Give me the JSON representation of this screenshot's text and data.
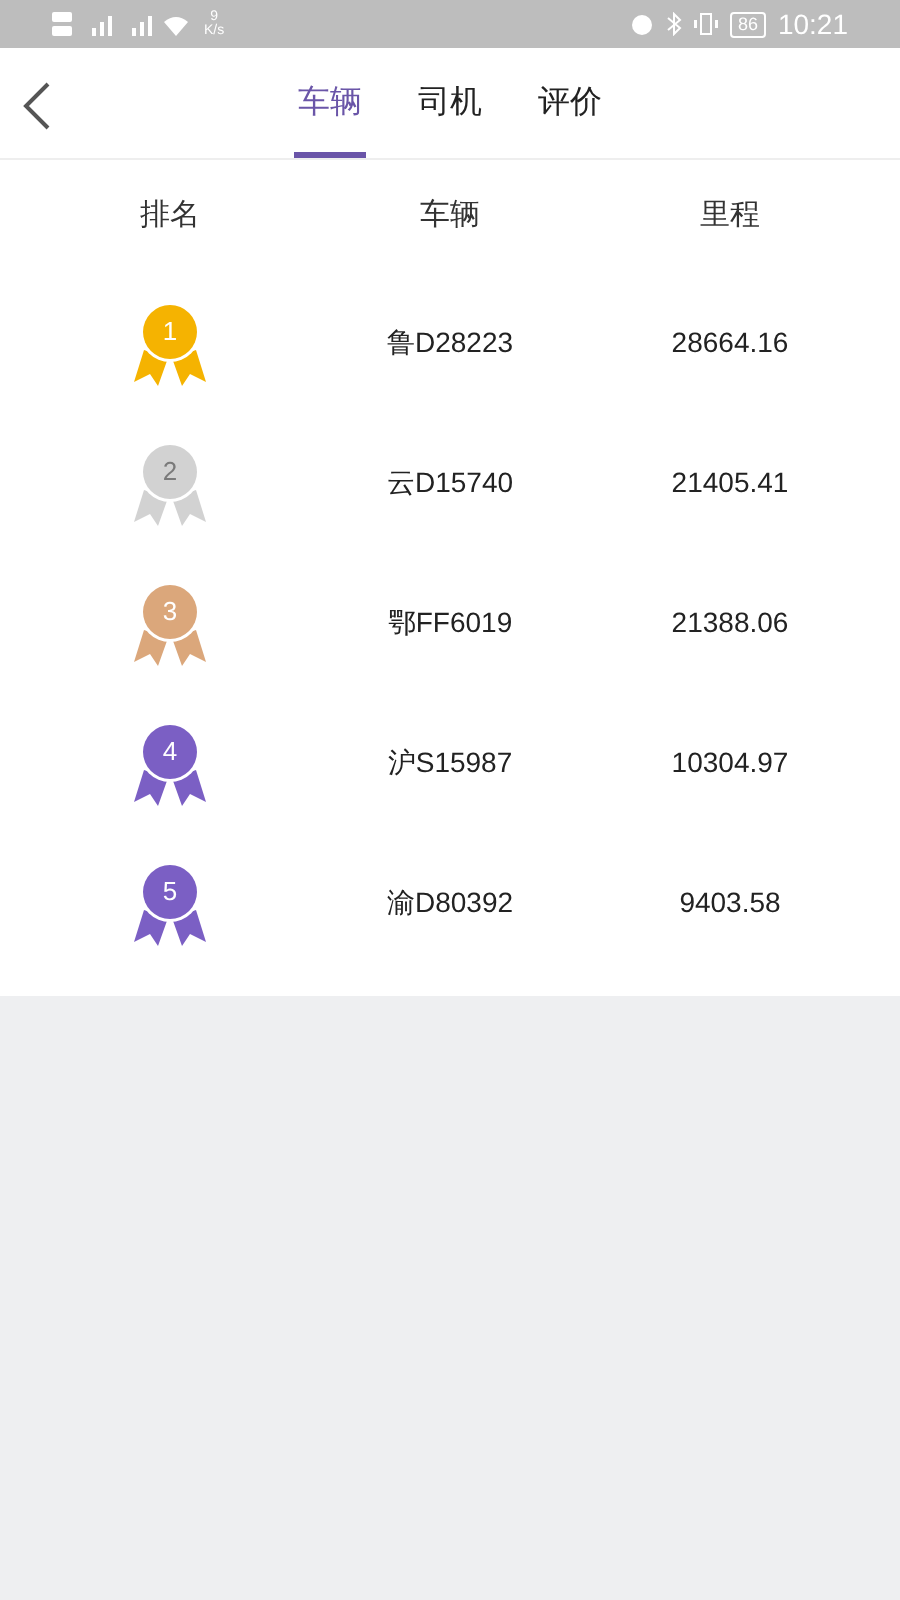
{
  "status_bar": {
    "net_speed": "9",
    "net_unit": "K/s",
    "battery": "86",
    "time": "10:21"
  },
  "tabs": [
    {
      "label": "车辆",
      "selected": true
    },
    {
      "label": "司机",
      "selected": false
    },
    {
      "label": "评价",
      "selected": false
    }
  ],
  "table": {
    "columns": [
      "排名",
      "车辆",
      "里程"
    ],
    "rows": [
      {
        "rank": "1",
        "color": "#f5b301",
        "vehicle": "鲁D28223",
        "mileage": "28664.16"
      },
      {
        "rank": "2",
        "color": "#d2d2d2",
        "vehicle": "云D15740",
        "mileage": "21405.41"
      },
      {
        "rank": "3",
        "color": "#dba77b",
        "vehicle": "鄂FF6019",
        "mileage": "21388.06"
      },
      {
        "rank": "4",
        "color": "#7b5fc4",
        "vehicle": "沪S15987",
        "mileage": "10304.97"
      },
      {
        "rank": "5",
        "color": "#7b5fc4",
        "vehicle": "渝D80392",
        "mileage": "9403.58"
      }
    ]
  }
}
